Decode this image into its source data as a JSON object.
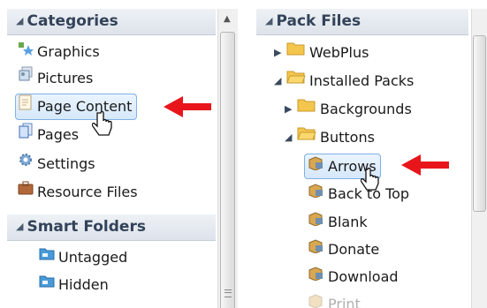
{
  "left": {
    "categories_header": "Categories",
    "categories": [
      {
        "label": "Graphics",
        "icon": "graphics-icon"
      },
      {
        "label": "Pictures",
        "icon": "pictures-icon"
      },
      {
        "label": "Page Content",
        "icon": "page-content-icon",
        "selected": true
      },
      {
        "label": "Pages",
        "icon": "pages-icon"
      },
      {
        "label": "Settings",
        "icon": "settings-icon"
      },
      {
        "label": "Resource Files",
        "icon": "resource-files-icon"
      }
    ],
    "smart_folders_header": "Smart Folders",
    "smart_folders": [
      {
        "label": "Untagged",
        "icon": "smart-folder-icon"
      },
      {
        "label": "Hidden",
        "icon": "smart-folder-icon"
      }
    ]
  },
  "right": {
    "header": "Pack Files",
    "tree": [
      {
        "label": "WebPlus",
        "icon": "folder-icon",
        "expander": "collapsed"
      },
      {
        "label": "Installed Packs",
        "icon": "folder-icon",
        "expander": "expanded"
      },
      {
        "label": "Backgrounds",
        "icon": "folder-icon",
        "expander": "collapsed"
      },
      {
        "label": "Buttons",
        "icon": "folder-icon",
        "expander": "expanded"
      },
      {
        "label": "Arrows",
        "icon": "pack-icon",
        "selected": true
      },
      {
        "label": "Back to Top",
        "icon": "pack-icon"
      },
      {
        "label": "Blank",
        "icon": "pack-icon"
      },
      {
        "label": "Donate",
        "icon": "pack-icon"
      },
      {
        "label": "Download",
        "icon": "pack-icon"
      },
      {
        "label": "Print",
        "icon": "pack-icon"
      }
    ]
  },
  "colors": {
    "header_text": "#33435a",
    "selection_border": "#7fb1e6",
    "arrow": "#e8161b"
  }
}
